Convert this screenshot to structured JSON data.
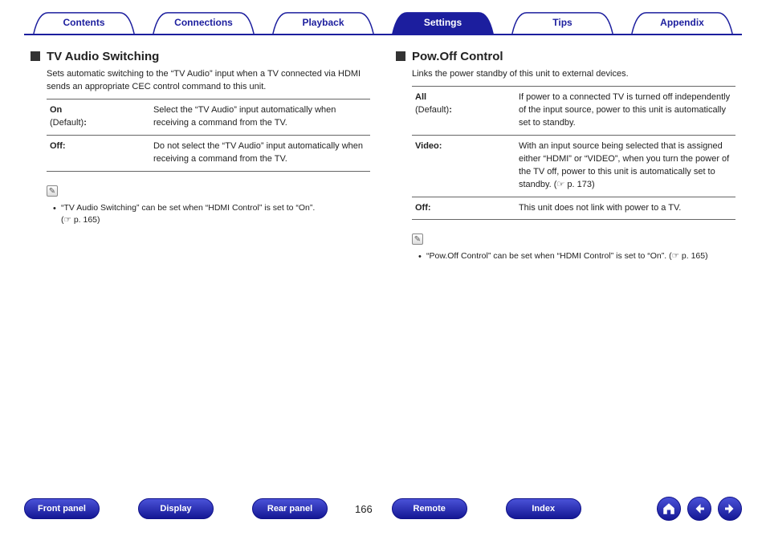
{
  "tabs": {
    "items": [
      {
        "label": "Contents"
      },
      {
        "label": "Connections"
      },
      {
        "label": "Playback"
      },
      {
        "label": "Settings",
        "active": true
      },
      {
        "label": "Tips"
      },
      {
        "label": "Appendix"
      }
    ]
  },
  "left": {
    "title": "TV Audio Switching",
    "desc": "Sets automatic switching to the “TV Audio” input when a TV connected via HDMI sends an appropriate CEC control command to this unit.",
    "rows": [
      {
        "key_bold": "On",
        "key_sub": "(Default)",
        "key_suffix": ":",
        "val": "Select the “TV Audio” input automatically when receiving a command from the TV."
      },
      {
        "key_bold": "Off:",
        "key_sub": "",
        "key_suffix": "",
        "val": "Do not select the “TV Audio” input automatically when receiving a command from the TV."
      }
    ],
    "note": "“TV Audio Switching” can be set when “HDMI Control” is set to “On”.",
    "note_ref": "(☞ p. 165)"
  },
  "right": {
    "title": "Pow.Off Control",
    "desc": "Links the power standby of this unit to external devices.",
    "rows": [
      {
        "key_bold": "All",
        "key_sub": "(Default)",
        "key_suffix": ":",
        "val": "If power to a connected TV is turned off independently of the input source, power to this unit is automatically set to standby."
      },
      {
        "key_bold": "Video:",
        "key_sub": "",
        "key_suffix": "",
        "val": "With an input source being selected that is assigned either “HDMI” or “VIDEO”, when you turn the power of the TV off, power to this unit is automatically set to standby.  (☞ p. 173)"
      },
      {
        "key_bold": "Off:",
        "key_sub": "",
        "key_suffix": "",
        "val": "This unit does not link with power to a TV."
      }
    ],
    "note": "“Pow.Off Control” can be set when “HDMI Control” is set to “On”.",
    "note_ref": "(☞ p. 165)"
  },
  "bottom": {
    "buttons": [
      "Front panel",
      "Display",
      "Rear panel",
      "Remote",
      "Index"
    ],
    "page": "166"
  }
}
